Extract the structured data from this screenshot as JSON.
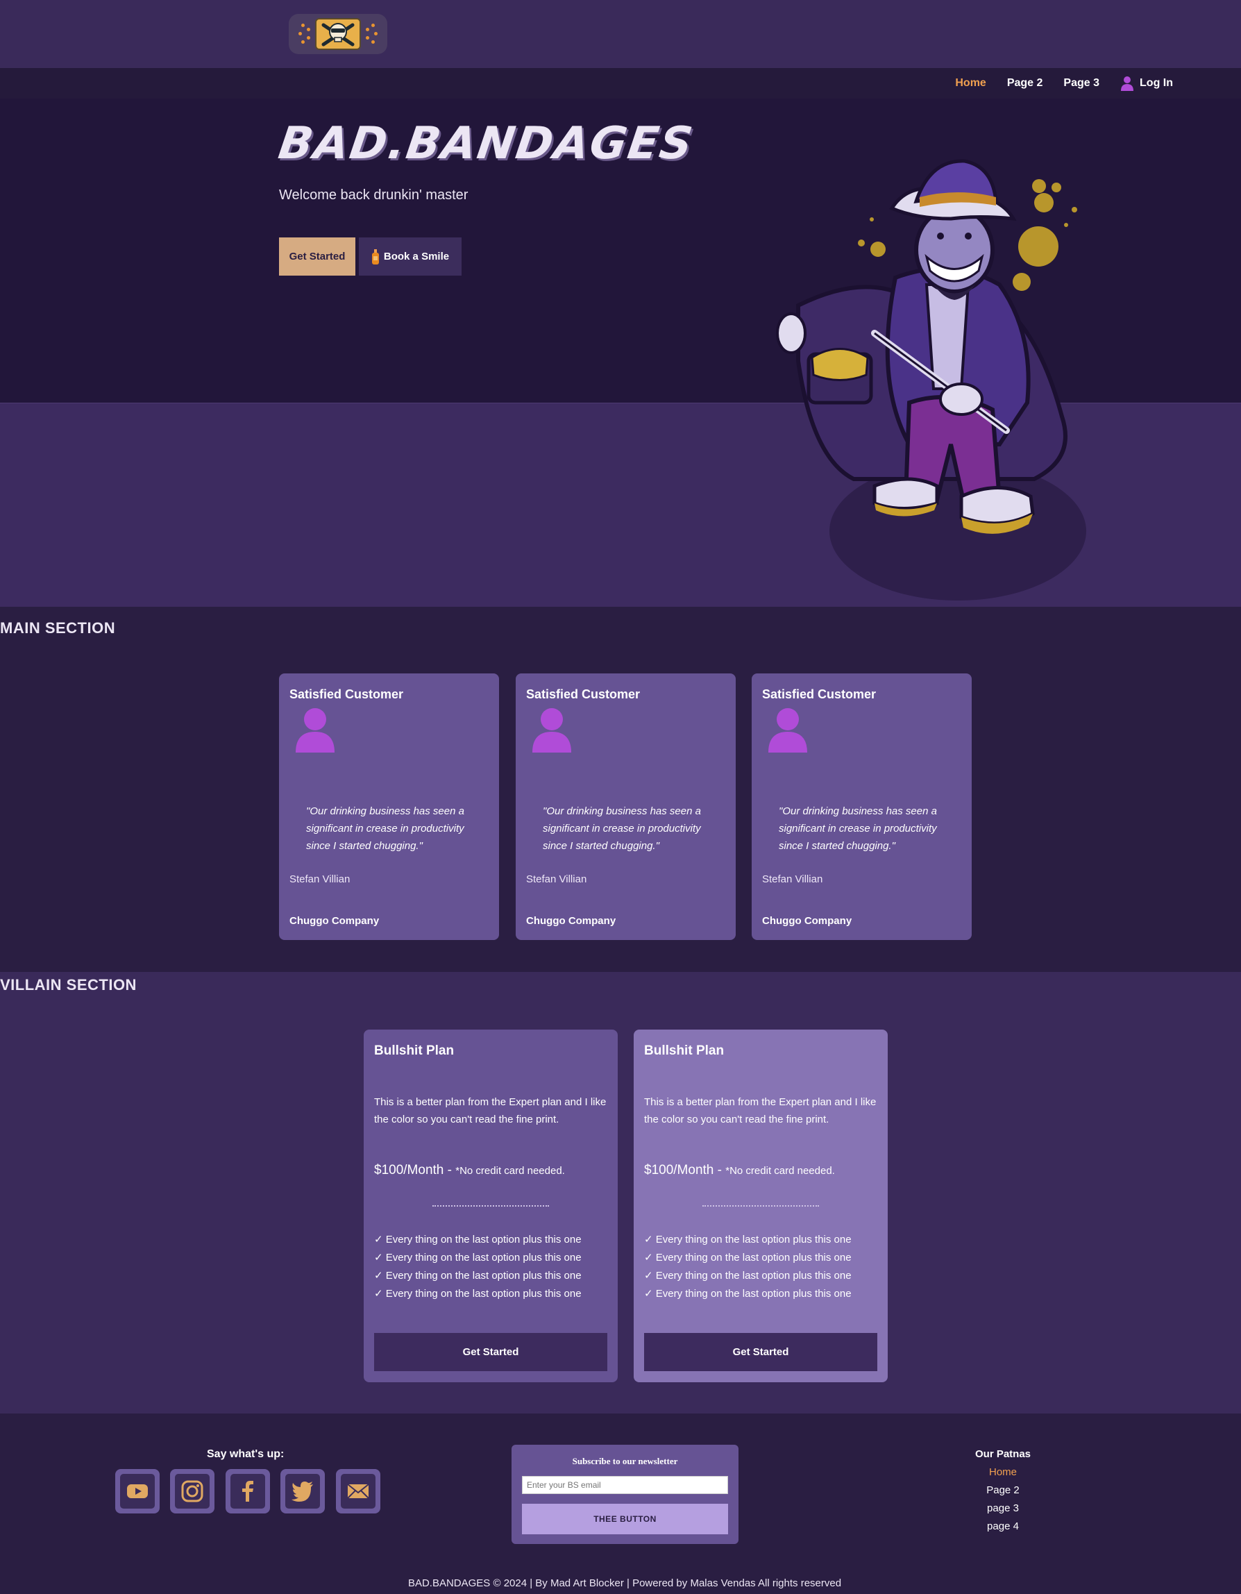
{
  "header": {
    "logo_alt": "Bad Bandages skull logo"
  },
  "nav": {
    "items": [
      {
        "label": "Home",
        "active": true
      },
      {
        "label": "Page 2"
      },
      {
        "label": "Page 3"
      }
    ],
    "login_label": "Log In"
  },
  "hero": {
    "brand": "BAD.BANDAGES",
    "welcome": "Welcome back drunkin' master",
    "primary_button": "Get Started",
    "secondary_button": "Book a Smile"
  },
  "main_section": {
    "title": "MAIN SECTION",
    "testimonials": [
      {
        "heading": "Satisfied Customer",
        "quote": "\"Our drinking business has seen a significant in crease in productivity since I started chugging.\"",
        "name": "Stefan Villian",
        "company": "Chuggo Company"
      },
      {
        "heading": "Satisfied Customer",
        "quote": "\"Our drinking business has seen a significant in crease in productivity since I started chugging.\"",
        "name": "Stefan Villian",
        "company": "Chuggo Company"
      },
      {
        "heading": "Satisfied Customer",
        "quote": "\"Our drinking business has seen a significant in crease in productivity since I started chugging.\"",
        "name": "Stefan Villian",
        "company": "Chuggo Company"
      }
    ]
  },
  "villain_section": {
    "title": "VILLAIN SECTION",
    "plans": [
      {
        "heading": "Bullshit Plan",
        "description": "This is a better plan from the Expert plan and I like the color so you can't read the fine print.",
        "price": "$100/Month - ",
        "price_note": "*No credit card needed.",
        "features": [
          "✓ Every thing on the last option plus this one",
          "✓ Every thing on the last option plus this one",
          "✓ Every thing on the last option plus this one",
          "✓ Every thing on the last option plus this one"
        ],
        "button": "Get Started",
        "color": "#665394"
      },
      {
        "heading": "Bullshit Plan",
        "description": "This is a better plan from the Expert plan and I like the color so you can't read the fine print.",
        "price": "$100/Month - ",
        "price_note": "*No credit card needed.",
        "features": [
          "✓ Every thing on the last option plus this one",
          "✓ Every thing on the last option plus this one",
          "✓ Every thing on the last option plus this one",
          "✓ Every thing on the last option plus this one"
        ],
        "button": "Get Started",
        "color": "#8774b4"
      }
    ]
  },
  "footer": {
    "social_heading": "Say what's up:",
    "social_icons": [
      "youtube-icon",
      "instagram-icon",
      "facebook-icon",
      "twitter-icon",
      "mail-icon"
    ],
    "newsletter": {
      "title": "Subscribe to our newsletter",
      "placeholder": "Enter your BS email",
      "button": "THEE BUTTON"
    },
    "partners": {
      "heading": "Our Patnas",
      "links": [
        {
          "label": "Home",
          "active": true
        },
        {
          "label": "Page 2"
        },
        {
          "label": "page 3"
        },
        {
          "label": "page 4"
        }
      ]
    },
    "copyright": "BAD.BANDAGES © 2024 | By Mad Art Blocker | Powered by Malas Vendas All rights reserved"
  },
  "colors": {
    "accent": "#f0a050",
    "primary_button": "#d6ab82",
    "card": "#665394",
    "card_alt": "#8774b4",
    "avatar": "#b04cd8",
    "background": "#2a1e42"
  }
}
